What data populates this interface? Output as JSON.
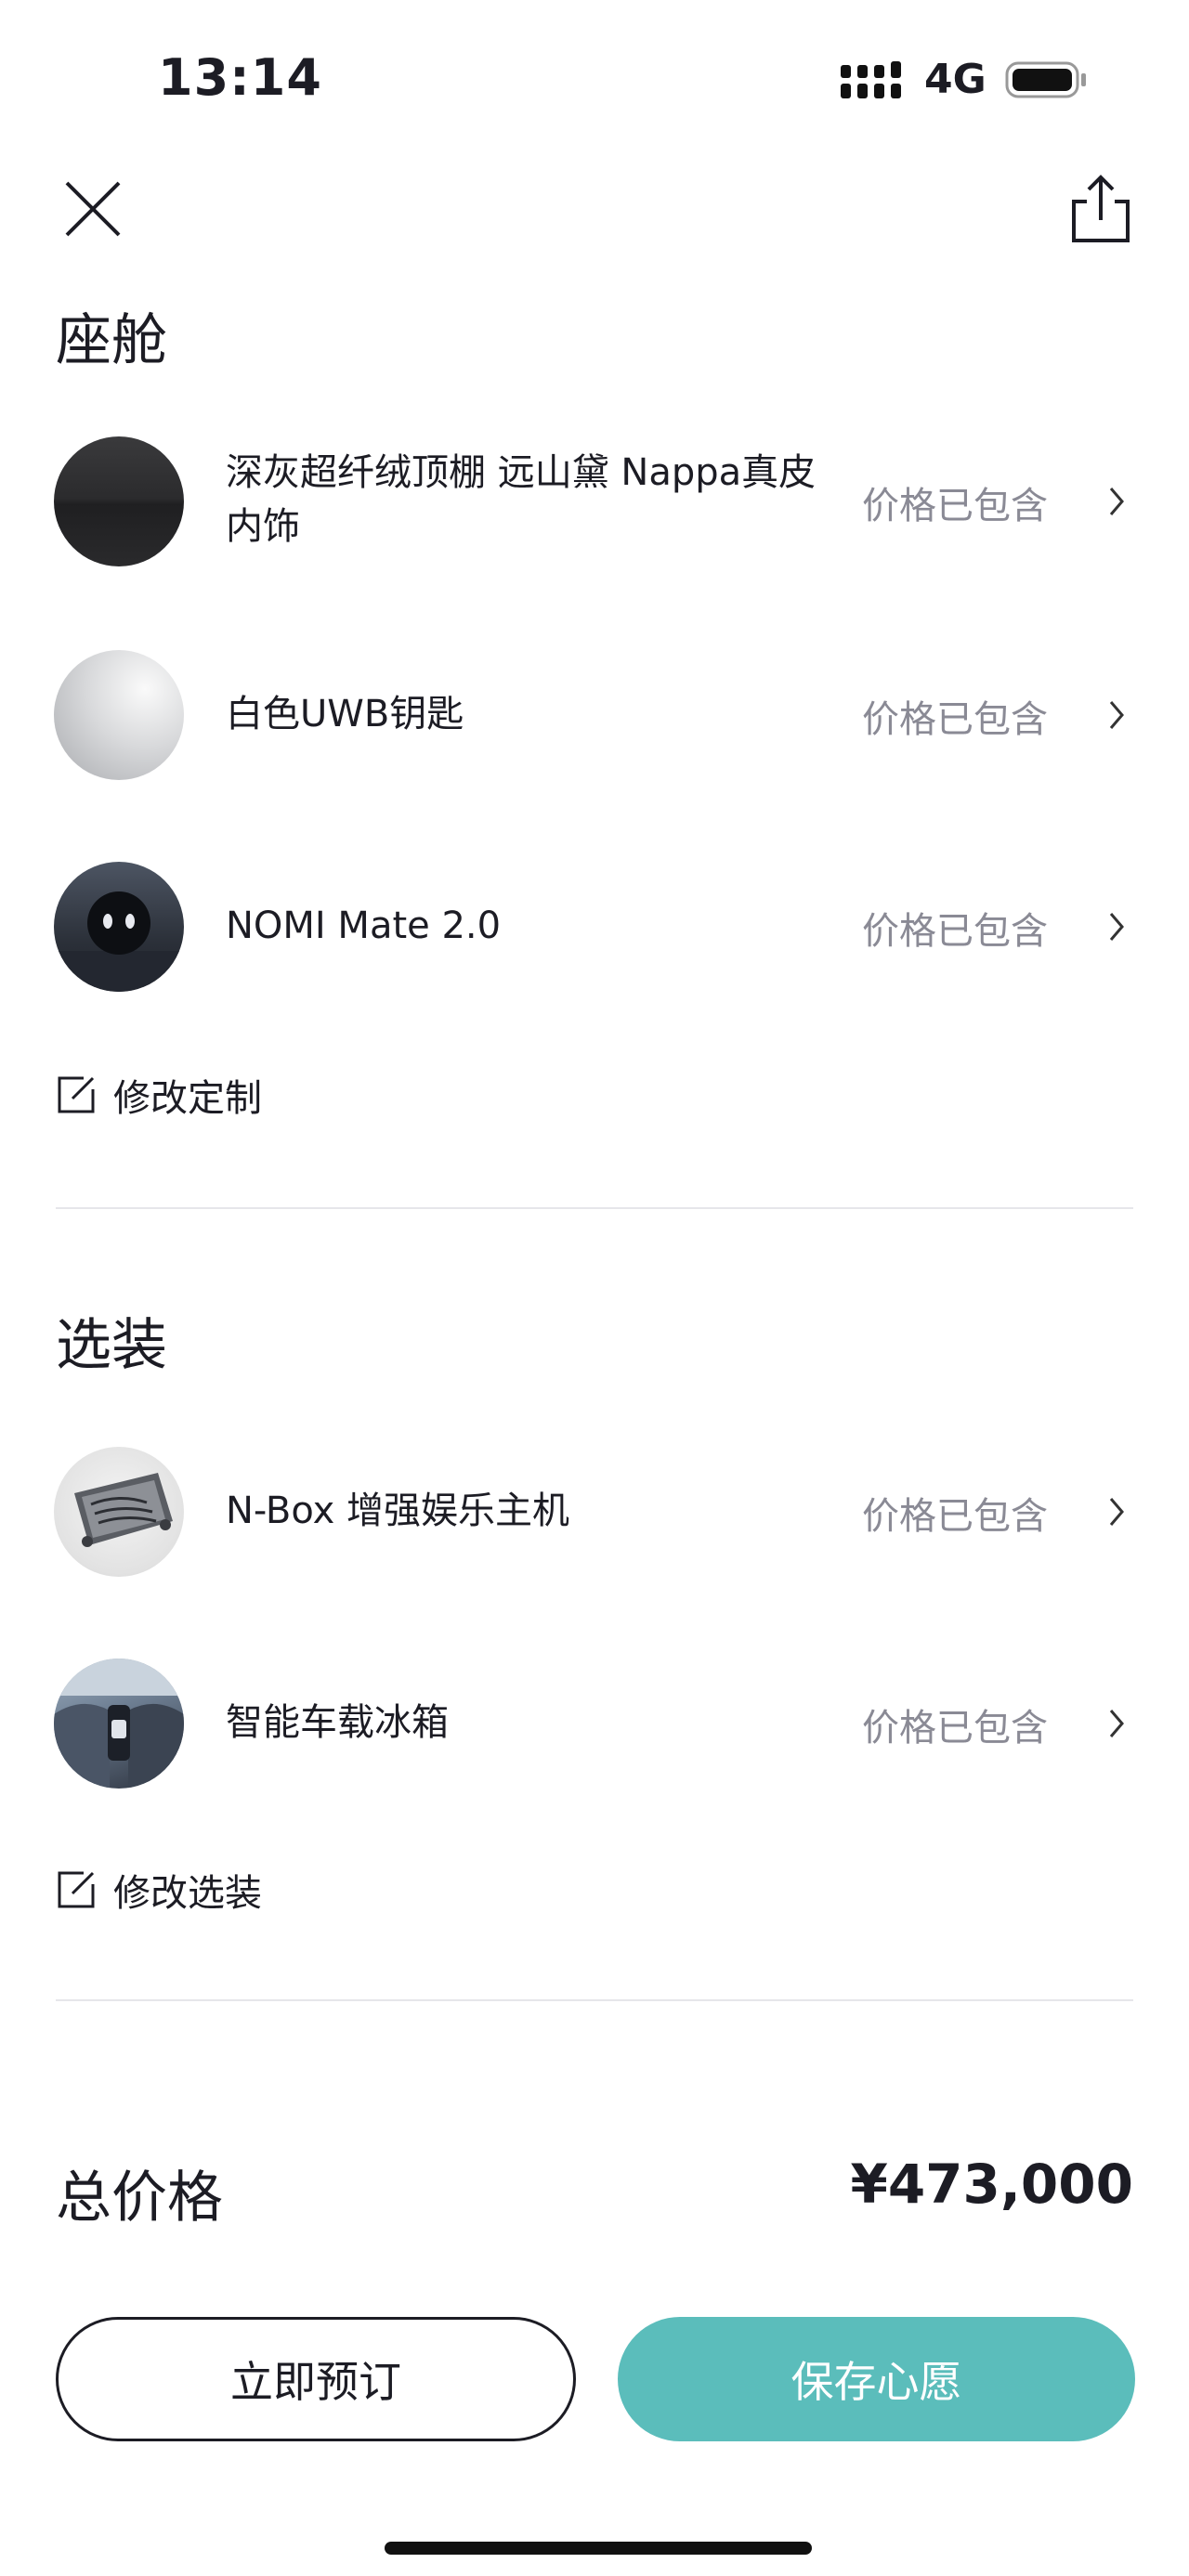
{
  "status_bar": {
    "time": "13:14",
    "network": "4G"
  },
  "sections": {
    "cabin": {
      "title": "座舱",
      "items": [
        {
          "name": "深灰超纤绒顶棚 远山黛 Nappa真皮内饰",
          "status": "价格已包含"
        },
        {
          "name": "白色UWB钥匙",
          "status": "价格已包含"
        },
        {
          "name": "NOMI Mate 2.0",
          "status": "价格已包含"
        }
      ],
      "modify_label": "修改定制"
    },
    "options": {
      "title": "选装",
      "items": [
        {
          "name": "N-Box 增强娱乐主机",
          "status": "价格已包含"
        },
        {
          "name": "智能车载冰箱",
          "status": "价格已包含"
        }
      ],
      "modify_label": "修改选装"
    }
  },
  "total": {
    "label": "总价格",
    "value": "¥473,000"
  },
  "actions": {
    "reserve_label": "立即预订",
    "save_label": "保存心愿"
  },
  "colors": {
    "accent": "#5bbdbb",
    "text": "#1c1c24",
    "muted": "#8a8a95"
  }
}
